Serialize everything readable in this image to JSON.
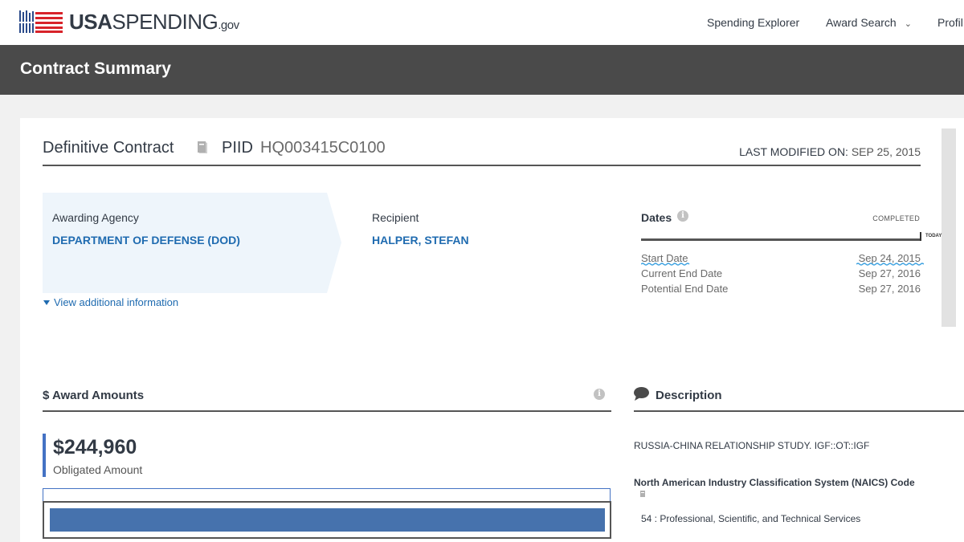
{
  "header": {
    "logo": {
      "usa": "USA",
      "spending": "SPENDING",
      "gov": ".gov"
    },
    "nav": [
      {
        "label": "Spending Explorer"
      },
      {
        "label": "Award Search"
      },
      {
        "label": "Profil"
      }
    ]
  },
  "page": {
    "title": "Contract Summary"
  },
  "award": {
    "type": "Definitive Contract",
    "piid_label": "PIID",
    "piid": "HQ003415C0100",
    "last_modified_label": "LAST MODIFIED ON:",
    "last_modified": "SEP 25, 2015"
  },
  "agency": {
    "label": "Awarding Agency",
    "value": "DEPARTMENT OF DEFENSE (DOD)"
  },
  "recipient": {
    "label": "Recipient",
    "value": "HALPER, STEFAN"
  },
  "view_more": "View additional information",
  "dates": {
    "title": "Dates",
    "status": "COMPLETED",
    "today_label": "TODAY",
    "rows": [
      {
        "label": "Start Date",
        "value": "Sep 24, 2015"
      },
      {
        "label": "Current End Date",
        "value": "Sep 27, 2016"
      },
      {
        "label": "Potential End Date",
        "value": "Sep 27, 2016"
      }
    ]
  },
  "amounts": {
    "title": "$ Award Amounts",
    "obligated_value": "$244,960",
    "obligated_label": "Obligated Amount",
    "bar_fill_fraction": 1.0,
    "bar_color": "#4672ad"
  },
  "description": {
    "title": "Description",
    "text": "RUSSIA-CHINA RELATIONSHIP STUDY. IGF::OT::IGF",
    "naics_label": "North American Industry Classification System (NAICS) Code",
    "naics_value": "54 : Professional, Scientific, and Technical Services"
  },
  "colors": {
    "link": "#1f6bb0",
    "title_bar": "#4a4a4a",
    "accent": "#4472c4"
  },
  "icons": [
    "usa-flag-logo-icon",
    "book-icon",
    "info-icon",
    "chevron-down-icon",
    "triangle-down-icon",
    "speech-bubble-icon"
  ]
}
